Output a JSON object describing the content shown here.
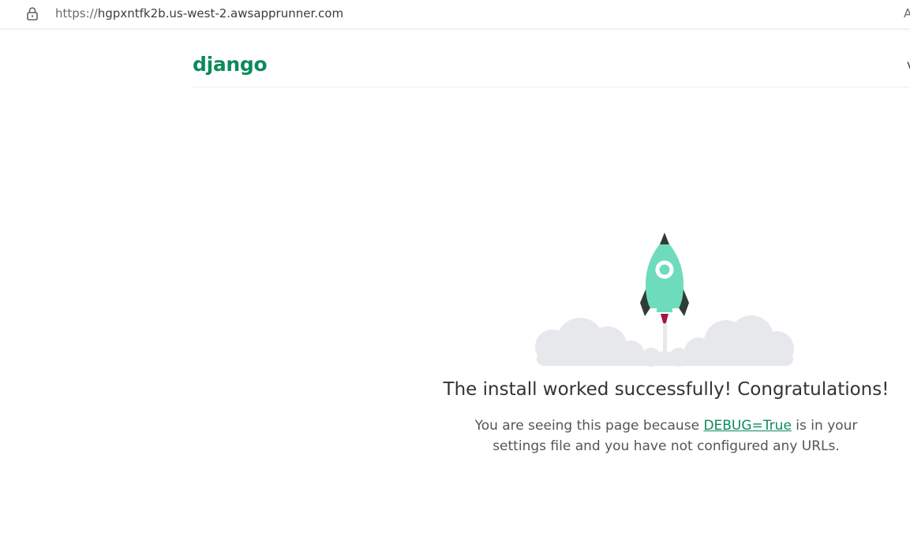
{
  "browser": {
    "url_scheme": "https://",
    "url_host": "hgpxntfk2b.us-west-2.awsapprunner.com",
    "right_edge_text": "A",
    "lock_icon": "lock-icon"
  },
  "header": {
    "logo_text": "django",
    "right_edge_text": "v"
  },
  "main": {
    "title": "The install worked successfully! Congratulations!",
    "subtitle_before": "You are seeing this page because ",
    "subtitle_link": "DEBUG=True",
    "subtitle_after": " is in your settings file and you have not configured any URLs."
  },
  "colors": {
    "brand_green": "#0c8a5a",
    "rocket_body": "#6ddcbd",
    "rocket_dark": "#2f3d3a",
    "flame": "#a6124a",
    "cloud": "#e6e8ec"
  }
}
